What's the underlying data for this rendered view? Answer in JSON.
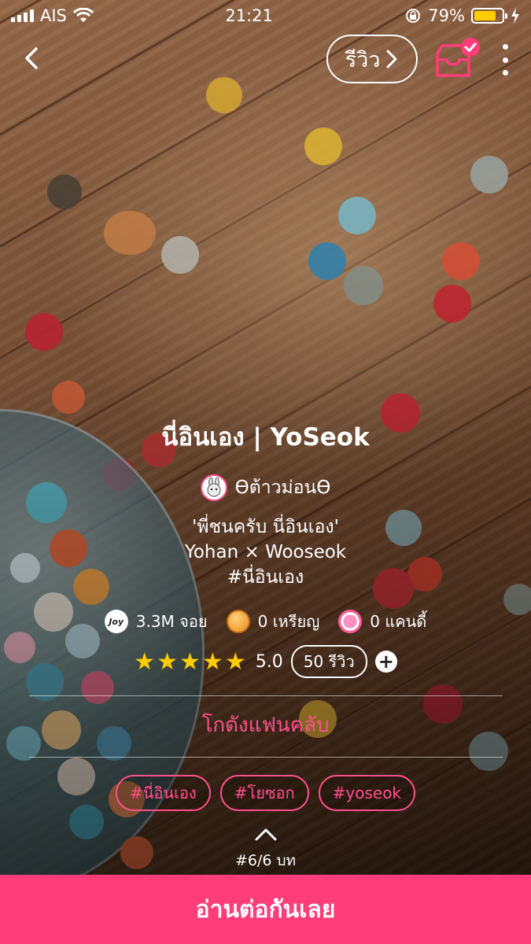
{
  "status_bar": {
    "carrier": "AIS",
    "time": "21:21",
    "battery_percent": "79%",
    "battery_level": 0.79
  },
  "nav": {
    "review_label": "รีวิว",
    "icons": [
      "chevron-left-icon",
      "chevron-right-icon",
      "shelf-check-icon",
      "more-vertical-icon"
    ]
  },
  "story": {
    "title": "นี่อินเอง | YoSeok",
    "author": "ϴต้าวม่อนϴ",
    "synopsis_line1": "'พี่ชนครับ นี่อินเอง'",
    "synopsis_line2": "Yohan × Wooseok",
    "synopsis_line3": "#นี่อินเอง"
  },
  "stats": {
    "joy_icon_text": "Joy",
    "joy": "3.3M จอย",
    "coins": "0 เหรียญ",
    "candy": "0 แคนดี้"
  },
  "rating": {
    "stars": "★★★★★",
    "score": "5.0",
    "review_count": "50 รีวิว",
    "plus": "+",
    "value": 5.0
  },
  "fanclub_label": "โกดังแฟนคลับ",
  "tags": [
    "#นี่อินเอง",
    "#โยซอก",
    "#yoseok"
  ],
  "episode": "#6/6 บท",
  "cta_label": "อ่านต่อกันเลย",
  "colors": {
    "accent": "#ff3d7a",
    "accent_text": "#ff4f8b",
    "star": "#ffcc00",
    "battery": "#ffcc00"
  }
}
